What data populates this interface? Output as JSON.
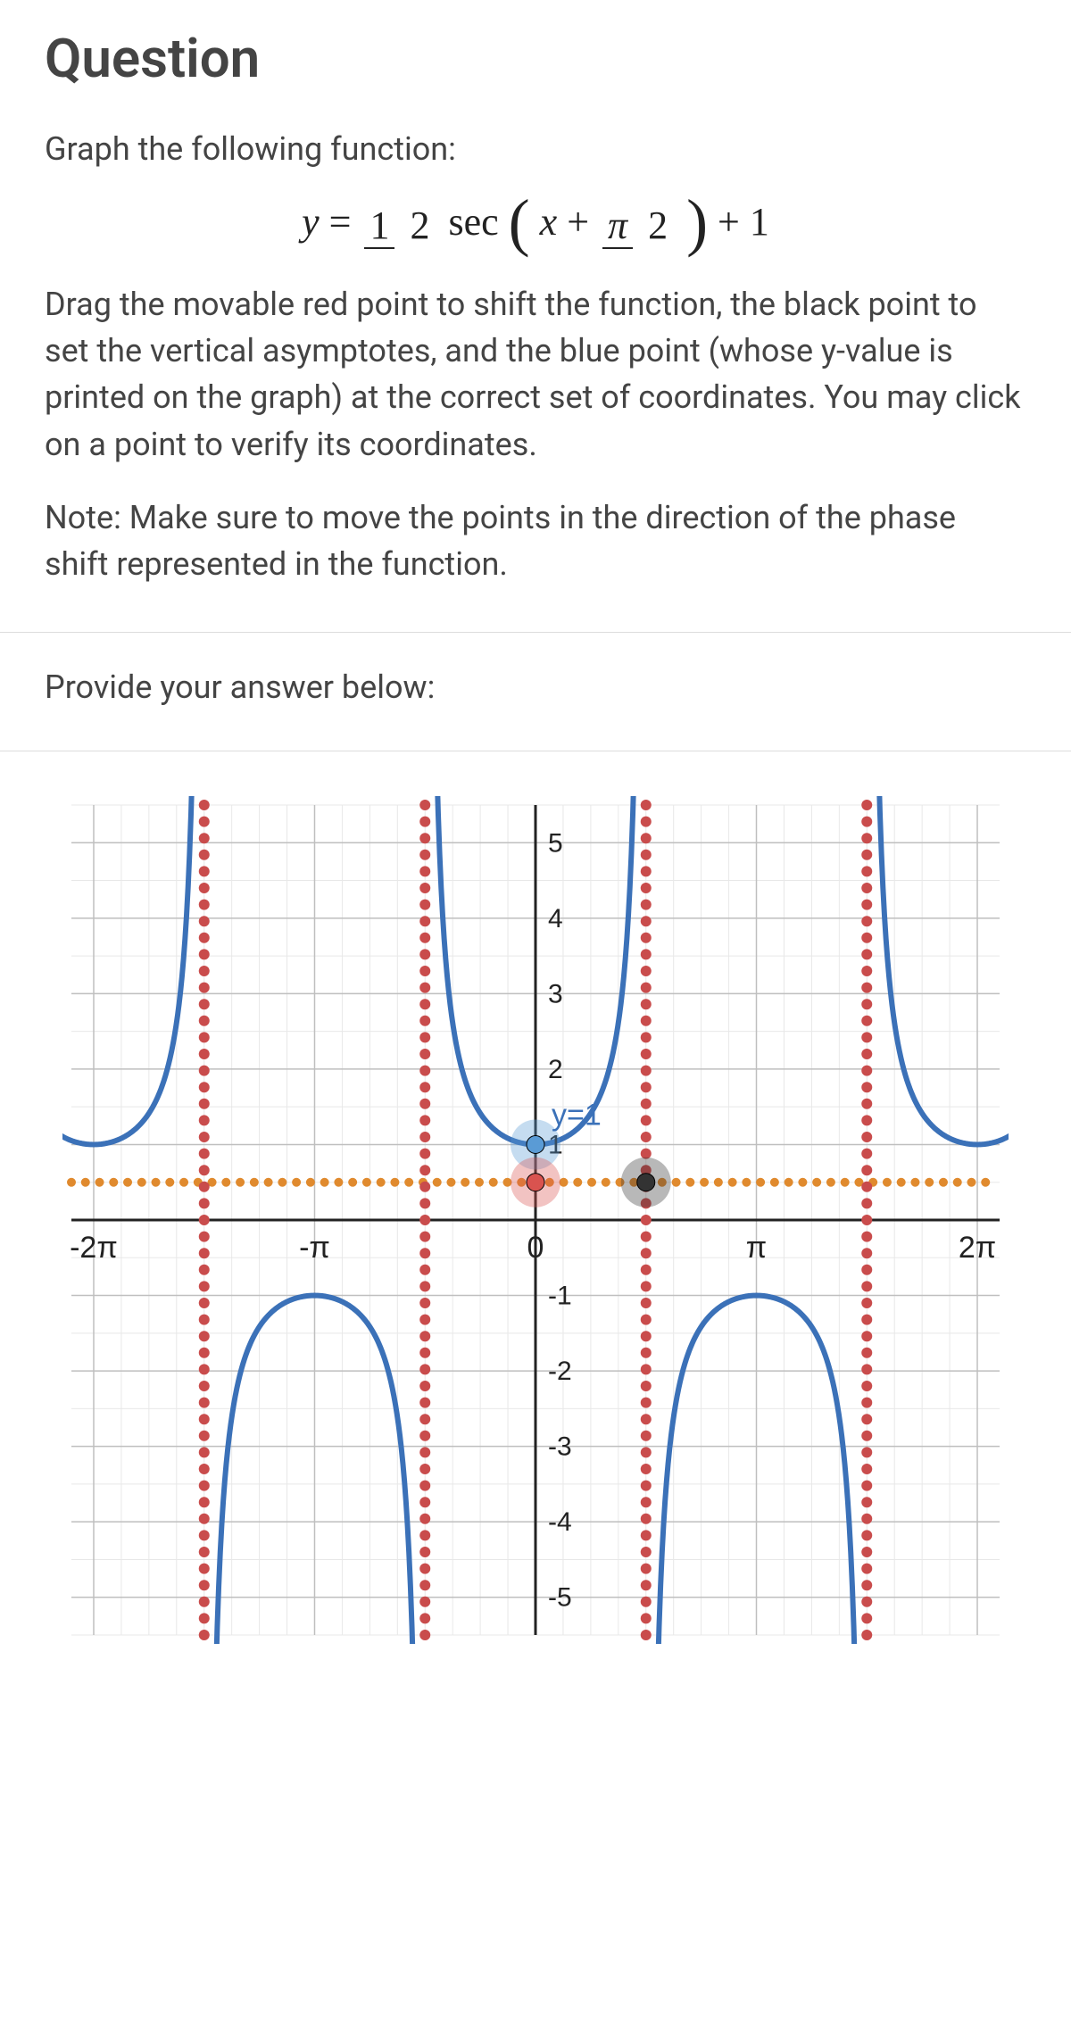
{
  "title": "Question",
  "instruction_lead": "Graph the following function:",
  "equation": {
    "lhs": "y",
    "coef_num": "1",
    "coef_den": "2",
    "func": "sec",
    "inner_var": "x",
    "inner_shift_num": "π",
    "inner_shift_den": "2",
    "outer_shift": "+ 1"
  },
  "instructions": [
    "Drag the movable red point to shift the function, the black point to set the vertical asymptotes, and the blue point (whose y-value is printed on the graph) at the correct set of coordinates. You may click on a point to verify its coordinates.",
    "Note: Make sure to move the points in the direction of the phase shift represented in the function."
  ],
  "answer_prompt": "Provide your answer below:",
  "chart_data": {
    "type": "line",
    "title": "",
    "xlabel": "",
    "ylabel": "",
    "xlim": [
      -6.6,
      6.6
    ],
    "ylim": [
      -5.5,
      5.5
    ],
    "x_ticks": [
      {
        "x": -6.283,
        "label": "-2π"
      },
      {
        "x": -3.1416,
        "label": "-π"
      },
      {
        "x": 0,
        "label": "0"
      },
      {
        "x": 3.1416,
        "label": "π"
      },
      {
        "x": 6.283,
        "label": "2π"
      }
    ],
    "y_ticks": [
      -5,
      -4,
      -3,
      -2,
      -1,
      1,
      2,
      3,
      4,
      5
    ],
    "asymptotes_x": [
      -4.712,
      -1.5708,
      1.5708,
      4.712
    ],
    "horizontal_dashed_y": 0.5,
    "series": [
      {
        "name": "sec-upper",
        "color": "#3b71b8",
        "branches": [
          {
            "center_x": -6.283,
            "min_y": 1,
            "dir": "up"
          },
          {
            "center_x": 0,
            "min_y": 1,
            "dir": "up"
          },
          {
            "center_x": 6.283,
            "min_y": 1,
            "dir": "up"
          }
        ]
      },
      {
        "name": "sec-lower",
        "color": "#3b71b8",
        "branches": [
          {
            "center_x": -3.1416,
            "max_y": -1,
            "dir": "down"
          },
          {
            "center_x": 3.1416,
            "max_y": -1,
            "dir": "down"
          }
        ]
      }
    ],
    "points": [
      {
        "name": "blue-point",
        "x": 0,
        "y": 1,
        "color": "#5a9bd5",
        "label": "y=1"
      },
      {
        "name": "red-point",
        "x": 0,
        "y": 0.5,
        "color": "#d9534f"
      },
      {
        "name": "black-point",
        "x": 1.5708,
        "y": 0.5,
        "color": "#333"
      }
    ]
  }
}
